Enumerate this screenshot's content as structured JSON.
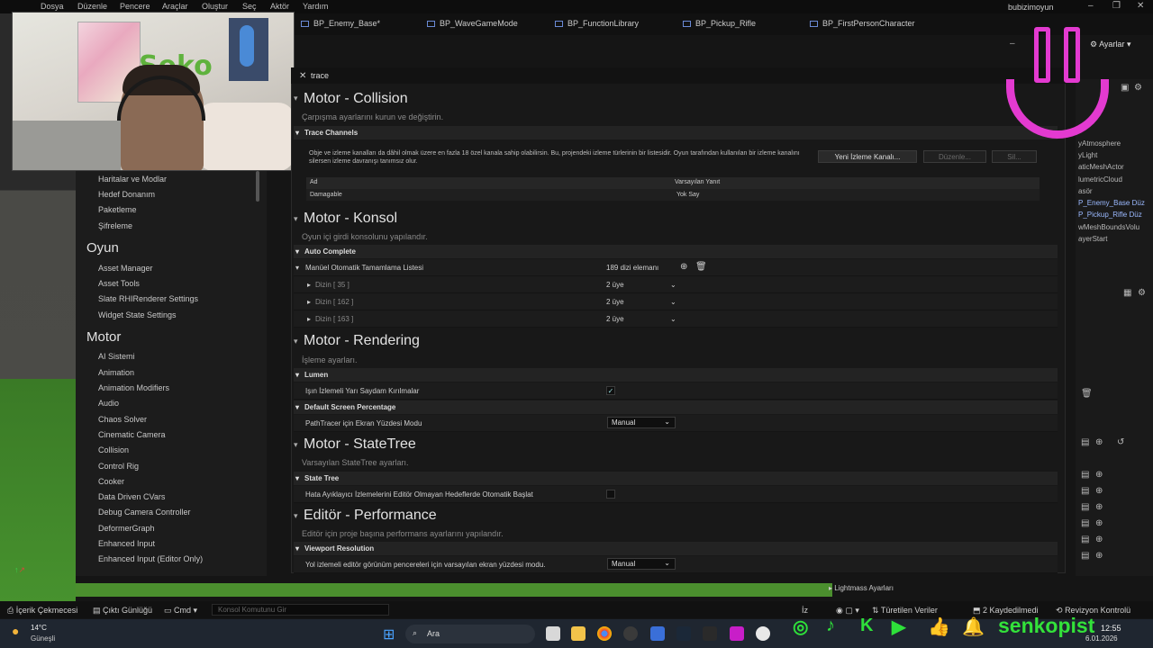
{
  "menubar": {
    "items": [
      "Dosya",
      "Düzenle",
      "Pencere",
      "Araçlar",
      "Oluştur",
      "Seç",
      "Aktör",
      "Yardım"
    ],
    "user": "bubizimoyun"
  },
  "tabs": [
    "BP_Enemy_Base*",
    "BP_WaveGameMode",
    "BP_FunctionLibrary",
    "BP_Pickup_Rifle",
    "BP_FirstPersonCharacter"
  ],
  "settings_label": "Ayarlar",
  "search": {
    "value": "trace"
  },
  "left_panel": {
    "items_top": [
      "Haritalar ve Modlar",
      "Hedef Donanım",
      "Paketleme",
      "Şifreleme"
    ],
    "cat_oyun": "Oyun",
    "items_oyun": [
      "Asset Manager",
      "Asset Tools",
      "Slate RHIRenderer Settings",
      "Widget State Settings"
    ],
    "cat_motor": "Motor",
    "items_motor": [
      "AI Sistemi",
      "Animation",
      "Animation Modifiers",
      "Audio",
      "Chaos Solver",
      "Cinematic Camera",
      "Collision",
      "Control Rig",
      "Cooker",
      "Data Driven CVars",
      "Debug Camera Controller",
      "DeformerGraph",
      "Enhanced Input",
      "Enhanced Input (Editor Only)"
    ]
  },
  "sections": {
    "collision": {
      "title": "Motor - Collision",
      "desc": "Çarpışma ayarlarını kurun ve değiştirin.",
      "group": "Trace Channels",
      "info": "Obje ve izleme kanalları da dâhil olmak üzere en fazla 18 özel kanala sahip olabilirsin. Bu, projendeki izleme türlerinin bir listesidir. Oyun tarafından kullanılan bir izleme kanalını silersen izleme davranışı tanımsız olur.",
      "btn_new": "Yeni İzleme Kanalı...",
      "btn_edit": "Düzenle...",
      "btn_delete": "Sil...",
      "col_name": "Ad",
      "col_default": "Varsayılan Yanıt",
      "row_name": "Damagable",
      "row_value": "Yok Say"
    },
    "konsol": {
      "title": "Motor - Konsol",
      "desc": "Oyun içi girdi konsolunu yapılandır.",
      "group": "Auto Complete",
      "list_label": "Manüel Otomatik Tamamlama Listesi",
      "list_count": "189 dizi elemanı",
      "entries": [
        {
          "label": "Dizin [ 35 ]",
          "value": "2 üye"
        },
        {
          "label": "Dizin [ 162 ]",
          "value": "2 üye"
        },
        {
          "label": "Dizin [ 163 ]",
          "value": "2 üye"
        }
      ]
    },
    "rendering": {
      "title": "Motor - Rendering",
      "desc": "İşleme ayarları.",
      "group1": "Lumen",
      "lumen_label": "Işın İzlemeli Yarı Saydam Kırılmalar",
      "lumen_checked": "✓",
      "group2": "Default Screen Percentage",
      "pt_label": "PathTracer için Ekran Yüzdesi Modu",
      "pt_value": "Manual"
    },
    "statetree": {
      "title": "Motor - StateTree",
      "desc": "Varsayılan StateTree ayarları.",
      "group": "State Tree",
      "label": "Hata Ayıklayıcı İzlemelerini Editör Olmayan Hedeflerde Otomatik Başlat"
    },
    "performance": {
      "title": "Editör - Performance",
      "desc": "Editör için proje başına performans ayarlarını yapılandır.",
      "group": "Viewport Resolution",
      "label": "Yol izlemeli editör görünüm pencereleri için varsayılan ekran yüzdesi modu.",
      "value": "Manual"
    }
  },
  "right_panel": {
    "items": [
      "yAtmosphere",
      "yLight",
      "aticMeshActor",
      "lumetricCloud",
      "asör",
      "P_Enemy_Base Düz",
      "P_Pickup_Rifle Düz",
      "wMeshBoundsVolu",
      "ayerStart"
    ],
    "lightmass": "Lightmass Ayarları"
  },
  "statusbar": {
    "content_drawer": "İçerik Çekmecesi",
    "output_log": "Çıktı Günlüğü",
    "cmd": "Cmd",
    "console_placeholder": "Konsol Komutunu Gir",
    "derived_data": "Türetilen Veriler",
    "unsaved": "2 Kaydedilmedi",
    "revision": "Revizyon Kontrolü",
    "iz": "İz"
  },
  "taskbar": {
    "weather_temp": "14°C",
    "weather_desc": "Güneşli",
    "search": "Ara",
    "time": "12:55",
    "date": "6.01.2026"
  },
  "overlay": {
    "brand": "senkopist"
  },
  "colors": {
    "accent_pink": "#e33ad0",
    "brand_green": "#33e23a"
  }
}
